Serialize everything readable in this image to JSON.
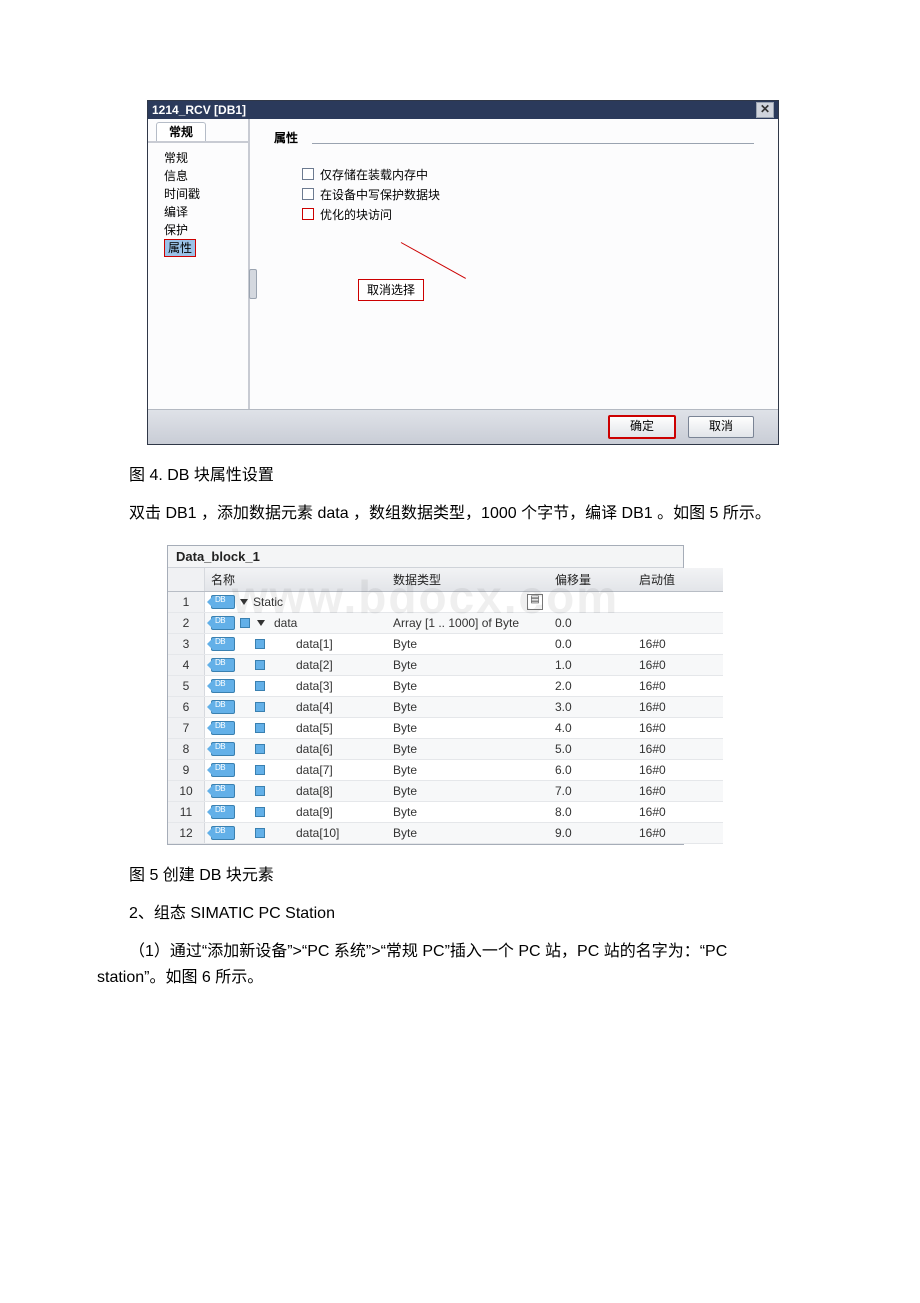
{
  "dialog": {
    "title": "1214_RCV [DB1]",
    "side_tab": "常规",
    "side_items": [
      "常规",
      "信息",
      "时间戳",
      "编译",
      "保护",
      "属性"
    ],
    "section_title": "属性",
    "checkboxes": [
      {
        "label": "仅存储在装载内存中",
        "checked": false
      },
      {
        "label": "在设备中写保护数据块",
        "checked": false
      },
      {
        "label": "优化的块访问",
        "checked": false
      }
    ],
    "callout": "取消选择",
    "ok_label": "确定",
    "cancel_label": "取消"
  },
  "caption1": "图 4. DB 块属性设置",
  "para1": "双击 DB1 ，添加数据元素 data ，数组数据类型，1000 个字节，编译 DB1 。如图 5 所示。",
  "datablock": {
    "title": "Data_block_1",
    "watermark": "www.bdocx.com",
    "headers": {
      "name": "名称",
      "type": "数据类型",
      "offset": "偏移量",
      "start": "启动值"
    },
    "rows": [
      {
        "n": "1",
        "kind": "root",
        "name": "Static",
        "type": "",
        "off": "",
        "start": ""
      },
      {
        "n": "2",
        "kind": "array",
        "name": "data",
        "type": "Array [1 .. 1000] of Byte",
        "off": "0.0",
        "start": ""
      },
      {
        "n": "3",
        "kind": "elem",
        "name": "data[1]",
        "type": "Byte",
        "off": "0.0",
        "start": "16#0"
      },
      {
        "n": "4",
        "kind": "elem",
        "name": "data[2]",
        "type": "Byte",
        "off": "1.0",
        "start": "16#0"
      },
      {
        "n": "5",
        "kind": "elem",
        "name": "data[3]",
        "type": "Byte",
        "off": "2.0",
        "start": "16#0"
      },
      {
        "n": "6",
        "kind": "elem",
        "name": "data[4]",
        "type": "Byte",
        "off": "3.0",
        "start": "16#0"
      },
      {
        "n": "7",
        "kind": "elem",
        "name": "data[5]",
        "type": "Byte",
        "off": "4.0",
        "start": "16#0"
      },
      {
        "n": "8",
        "kind": "elem",
        "name": "data[6]",
        "type": "Byte",
        "off": "5.0",
        "start": "16#0"
      },
      {
        "n": "9",
        "kind": "elem",
        "name": "data[7]",
        "type": "Byte",
        "off": "6.0",
        "start": "16#0"
      },
      {
        "n": "10",
        "kind": "elem",
        "name": "data[8]",
        "type": "Byte",
        "off": "7.0",
        "start": "16#0"
      },
      {
        "n": "11",
        "kind": "elem",
        "name": "data[9]",
        "type": "Byte",
        "off": "8.0",
        "start": "16#0"
      },
      {
        "n": "12",
        "kind": "elem",
        "name": "data[10]",
        "type": "Byte",
        "off": "9.0",
        "start": "16#0"
      }
    ]
  },
  "caption2": "图 5 创建 DB 块元素",
  "heading2": "2、组态 SIMATIC PC Station",
  "para2": "（1）通过“添加新设备”>“PC 系统”>“常规 PC”插入一个 PC 站，PC 站的名字为：“PC station”。如图 6 所示。"
}
